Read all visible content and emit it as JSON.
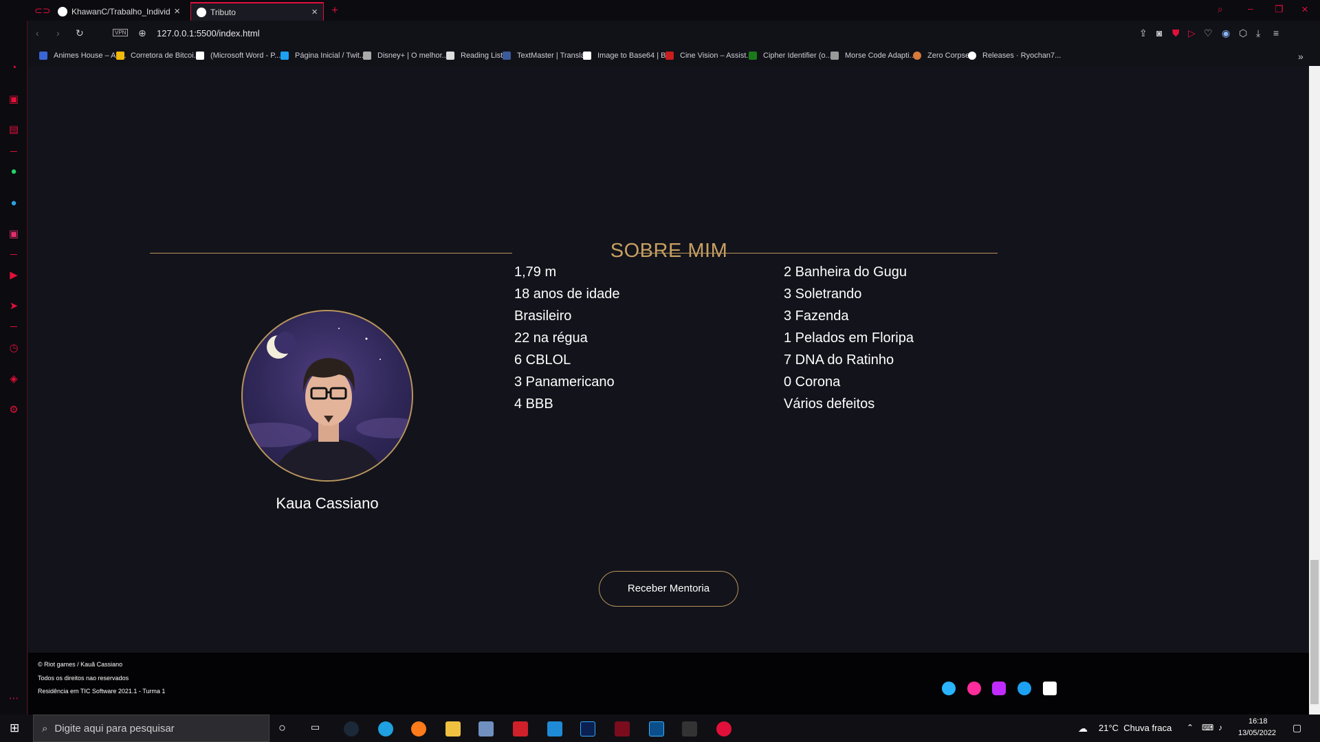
{
  "browser": {
    "tabs": [
      {
        "title": "KhawanC/Trabalho_Individ"
      },
      {
        "title": "Tributo"
      }
    ],
    "url": "127.0.0.1:5500/index.html",
    "vpn_label": "VPN",
    "bookmarks": [
      "Animes House – An...",
      "Corretora de Bitcoi...",
      "(Microsoft Word - P...",
      "Página Inicial / Twit...",
      "Disney+ | O melhor...",
      "Reading List",
      "TextMaster | Transla...",
      "Image to Base64 | B...",
      "Cine Vision – Assist...",
      "Cipher Identifier (o...",
      "Morse Code Adapti...",
      "Zero Corpse",
      "Releases · Ryochan7..."
    ]
  },
  "section": {
    "title": "SOBRE MIM",
    "profile_name": "Kaua Cassiano",
    "facts_left": [
      "1,79 m",
      "18 anos de idade",
      "Brasileiro",
      "22 na régua",
      "6 CBLOL",
      "3 Panamericano",
      "4 BBB"
    ],
    "facts_right": [
      "2 Banheira do Gugu",
      "3 Soletrando",
      "3 Fazenda",
      "1 Pelados em Floripa",
      "7 DNA do Ratinho",
      "0 Corona",
      "Vários defeitos"
    ],
    "button_label": "Receber Mentoria"
  },
  "footer": {
    "lines": [
      "© Riot games / Kauã Cassiano",
      "Todos os direitos nao reservados",
      "Residência em TIC Software 2021.1 - Turma 1"
    ],
    "social_icons": [
      "github-icon",
      "facebook-icon",
      "youtube-icon",
      "twitter-icon",
      "linkedin-icon"
    ]
  },
  "taskbar": {
    "search_placeholder": "Digite aqui para pesquisar",
    "weather": "21°C  Chuva fraca",
    "time": "16:18",
    "date": "13/05/2022"
  },
  "colors": {
    "accent_gold": "#c7a061",
    "browser_red": "#e0103a",
    "page_bg": "#13131b",
    "footer_bg": "#030305"
  }
}
